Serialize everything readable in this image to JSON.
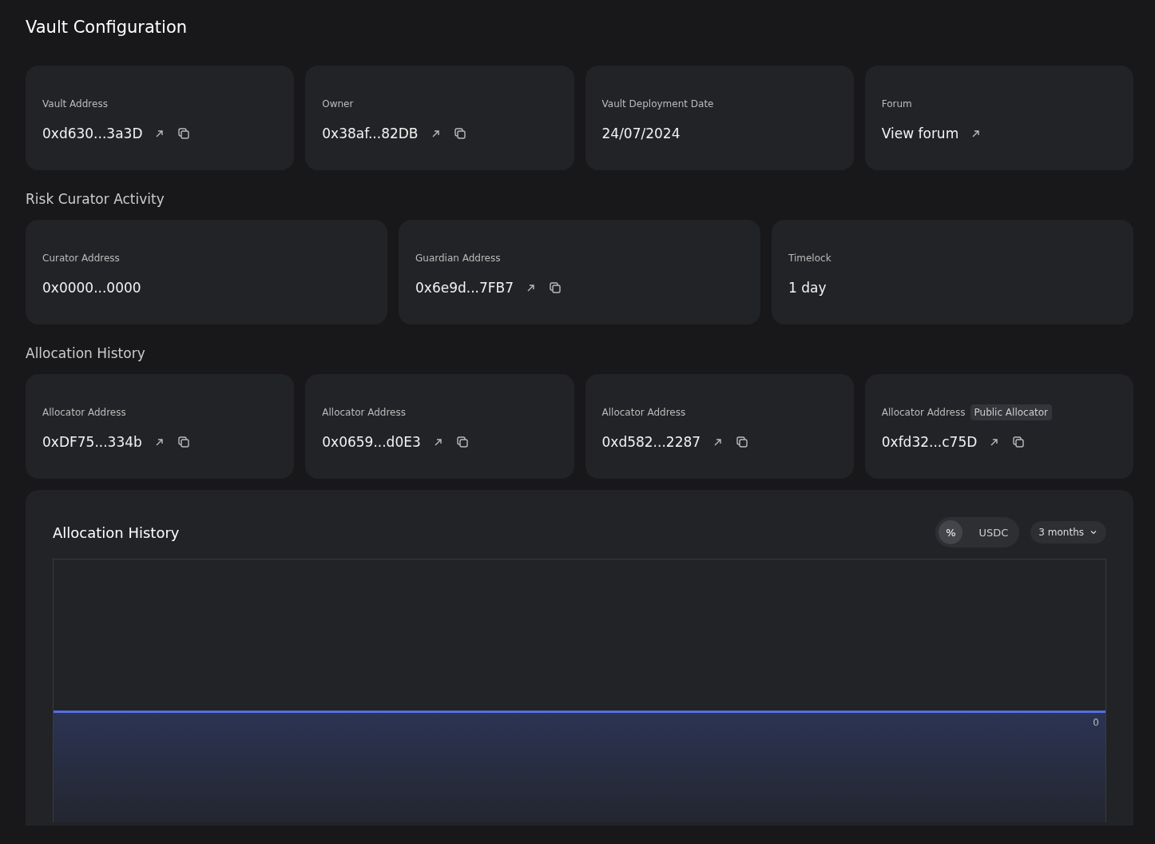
{
  "title": "Vault Configuration",
  "sections": [
    {
      "cards": [
        {
          "label": "Vault Address",
          "value": "0xd630...3a3D",
          "external_link": true,
          "copy": true
        },
        {
          "label": "Owner",
          "value": "0x38af...82DB",
          "external_link": true,
          "copy": true
        },
        {
          "label": "Vault Deployment Date",
          "value": "24/07/2024",
          "external_link": false,
          "copy": false
        },
        {
          "label": "Forum",
          "value": "View forum",
          "external_link": true,
          "copy": false
        }
      ]
    },
    {
      "heading": "Risk Curator Activity",
      "cards": [
        {
          "label": "Curator Address",
          "value": "0x0000...0000",
          "external_link": false,
          "copy": false
        },
        {
          "label": "Guardian Address",
          "value": "0x6e9d...7FB7",
          "external_link": true,
          "copy": true
        },
        {
          "label": "Timelock",
          "value": "1 day",
          "external_link": false,
          "copy": false
        }
      ]
    },
    {
      "heading": "Allocation History",
      "cards": [
        {
          "label": "Allocator Address",
          "value": "0xDF75...334b",
          "external_link": true,
          "copy": true
        },
        {
          "label": "Allocator Address",
          "value": "0x0659...d0E3",
          "external_link": true,
          "copy": true
        },
        {
          "label": "Allocator Address",
          "value": "0xd582...2287",
          "external_link": true,
          "copy": true
        },
        {
          "label": "Allocator Address",
          "badge": "Public Allocator",
          "value": "0xfd32...c75D",
          "external_link": true,
          "copy": true
        }
      ]
    }
  ],
  "chart_panel": {
    "title": "Allocation History",
    "unit_toggle": [
      {
        "label": "%",
        "selected": true
      },
      {
        "label": "USDC",
        "selected": false
      }
    ],
    "period": "3 months",
    "axis_label": "0"
  }
}
